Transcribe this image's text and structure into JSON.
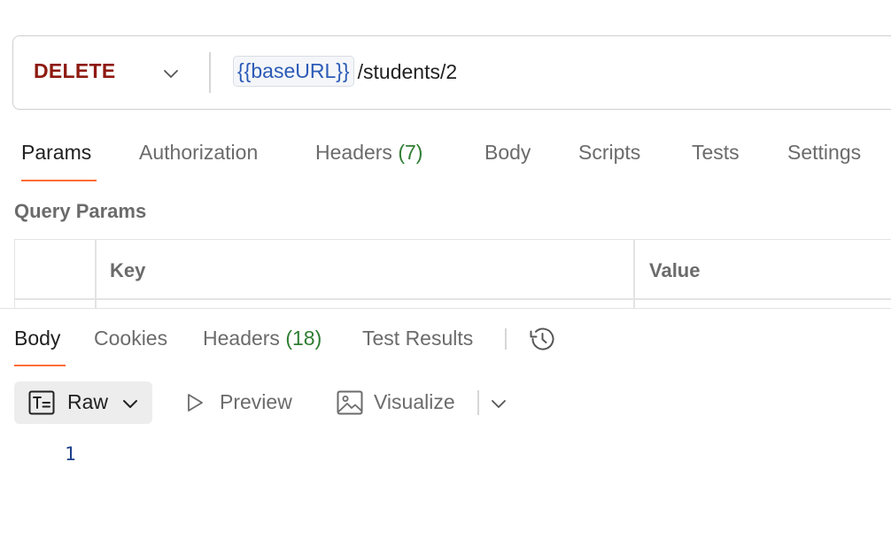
{
  "request": {
    "method": "DELETE",
    "url_variable": "{{baseURL}}",
    "url_path": "/students/2",
    "method_color": "#8e1a10"
  },
  "request_tabs": [
    {
      "label": "Params",
      "count": ""
    },
    {
      "label": "Authorization",
      "count": ""
    },
    {
      "label": "Headers",
      "count": "(7)"
    },
    {
      "label": "Body",
      "count": ""
    },
    {
      "label": "Scripts",
      "count": ""
    },
    {
      "label": "Tests",
      "count": ""
    },
    {
      "label": "Settings",
      "count": ""
    }
  ],
  "query_params": {
    "title": "Query Params",
    "columns": [
      "Key",
      "Value"
    ]
  },
  "response_tabs": [
    {
      "label": "Body",
      "count": ""
    },
    {
      "label": "Cookies",
      "count": ""
    },
    {
      "label": "Headers",
      "count": "(18)"
    },
    {
      "label": "Test Results",
      "count": ""
    }
  ],
  "format_toolbar": {
    "raw_label": "Raw",
    "preview_label": "Preview",
    "visualize_label": "Visualize"
  },
  "body_editor": {
    "line_numbers": [
      "1"
    ]
  },
  "icons": {
    "method_dropdown": "chevron-down-icon",
    "history": "history-icon",
    "raw": "text-format-icon",
    "preview": "play-triangle-icon",
    "visualize": "image-icon",
    "visualize_dropdown": "chevron-down-icon"
  },
  "colors": {
    "accent": "#ff6c37",
    "count": "#2e7d32",
    "variable": "#2c5bb7"
  }
}
